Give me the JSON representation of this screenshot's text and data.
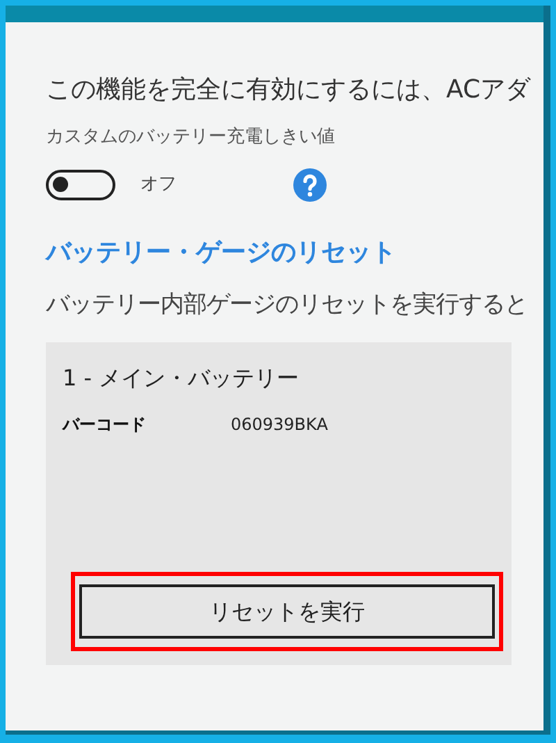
{
  "intro_text": "この機能を完全に有効にするには、ACアダ",
  "threshold": {
    "label": "カスタムのバッテリー充電しきい値",
    "on": false,
    "state_label": "オフ"
  },
  "gauge_reset": {
    "heading": "バッテリー・ゲージのリセット",
    "description": "バッテリー内部ゲージのリセットを実行すると",
    "battery": {
      "title": "1 - メイン・バッテリー",
      "field_label": "バーコード",
      "field_value": "060939BKA",
      "button": "リセットを実行",
      "highlighted": true
    }
  }
}
